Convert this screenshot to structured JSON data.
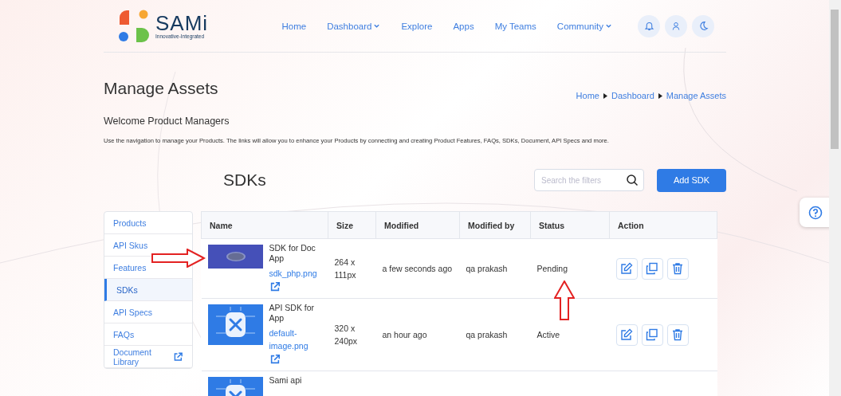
{
  "header": {
    "logo_name": "SAMi",
    "logo_tagline": "Innovative-Integrated",
    "nav": [
      {
        "label": "Home",
        "dropdown": false
      },
      {
        "label": "Dashboard",
        "dropdown": true
      },
      {
        "label": "Explore",
        "dropdown": false
      },
      {
        "label": "Apps",
        "dropdown": false
      },
      {
        "label": "My Teams",
        "dropdown": false
      },
      {
        "label": "Community",
        "dropdown": true
      }
    ]
  },
  "page": {
    "title": "Manage Assets",
    "breadcrumb": [
      "Home",
      "Dashboard",
      "Manage Assets"
    ],
    "welcome": "Welcome Product Managers",
    "description": "Use the navigation to manage your Products. The links will allow you to enhance your Products by connecting and creating Product Features, FAQs, SDKs, Document, API Specs and more."
  },
  "sidebar": {
    "items": [
      {
        "label": "Products",
        "selected": false,
        "external": false
      },
      {
        "label": "API Skus",
        "selected": false,
        "external": false
      },
      {
        "label": "Features",
        "selected": false,
        "external": false
      },
      {
        "label": "SDKs",
        "selected": true,
        "external": false
      },
      {
        "label": "API Specs",
        "selected": false,
        "external": false
      },
      {
        "label": "FAQs",
        "selected": false,
        "external": false
      },
      {
        "label": "Document Library",
        "selected": false,
        "external": true
      }
    ]
  },
  "section": {
    "title": "SDKs",
    "search": {
      "placeholder": "Search the filters"
    },
    "add_button": "Add SDK"
  },
  "table": {
    "columns": [
      "Name",
      "Size",
      "Modified",
      "Modified by",
      "Status",
      "Action"
    ],
    "rows": [
      {
        "name": "SDK for Doc App",
        "file": "sdk_php.png",
        "size": "264 x 111px",
        "modified": "a few seconds ago",
        "modified_by": "qa prakash",
        "status": "Pending"
      },
      {
        "name": "API SDK for App",
        "file": "default-image.png",
        "size": "320 x 240px",
        "modified": "an hour ago",
        "modified_by": "qa prakash",
        "status": "Active"
      },
      {
        "name": "Sami api"
      }
    ]
  }
}
